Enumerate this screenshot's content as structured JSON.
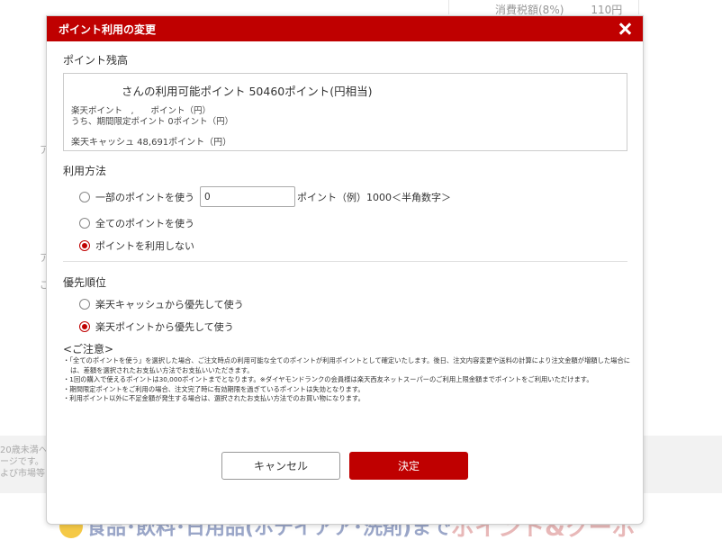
{
  "background": {
    "tax_label": "消費税額(8%)",
    "tax_amount": "110円",
    "left_fragments": [
      "ア",
      "ア",
      "ご"
    ],
    "band_lines": [
      "20歳未満へ",
      "ージです。",
      "よび市場等"
    ],
    "promo_text_a": "食品･飲料･日用品(ホテイアア･洗剤)まで",
    "promo_text_b": "ポイント&クーポン祭"
  },
  "modal": {
    "title": "ポイント利用の変更",
    "balance": {
      "section_label": "ポイント残高",
      "available_text": "さんの利用可能ポイント 50460ポイント(円相当)",
      "rakuten_points_line": "楽天ポイント　,　　ポイント（円）",
      "limited_points_line": "うち、期間限定ポイント 0ポイント（円）",
      "cash_line": "楽天キャッシュ 48,691ポイント（円）"
    },
    "usage": {
      "section_label": "利用方法",
      "options": [
        {
          "label": "一部のポイントを使う",
          "checked": false
        },
        {
          "label": "全てのポイントを使う",
          "checked": false
        },
        {
          "label": "ポイントを利用しない",
          "checked": true
        }
      ],
      "point_input_value": "0",
      "point_suffix": "ポイント（例）1000＜半角数字＞"
    },
    "priority": {
      "section_label": "優先順位",
      "options": [
        {
          "label": "楽天キャッシュから優先して使う",
          "checked": false
        },
        {
          "label": "楽天ポイントから優先して使う",
          "checked": true
        }
      ]
    },
    "notes": {
      "title": "<ご注意>",
      "items": [
        "・「全てのポイントを使う」を選択した場合、ご注文時点の利用可能な全てのポイントが利用ポイントとして確定いたします。後日、注文内容変更や送料の計算により注文金額が増額した場合には、差額を選択されたお支払い方法でお支払いいただきます。",
        "・1回の購入で使えるポイントは30,000ポイントまでとなります。※ダイヤモンドランクの会員様は楽天西友ネットスーパーのご利用上限金額までポイントをご利用いただけます。",
        "・期間限定ポイントをご利用の場合、注文完了時に有効期限を過ぎているポイントは失効となります。",
        "・利用ポイント以外に不足金額が発生する場合は、選択されたお支払い方法でのお買い物になります。"
      ]
    },
    "buttons": {
      "cancel": "キャンセル",
      "ok": "決定"
    }
  },
  "colors": {
    "accent": "#bf0000",
    "border": "#cccccc"
  },
  "icons": {
    "close": "close-icon"
  }
}
